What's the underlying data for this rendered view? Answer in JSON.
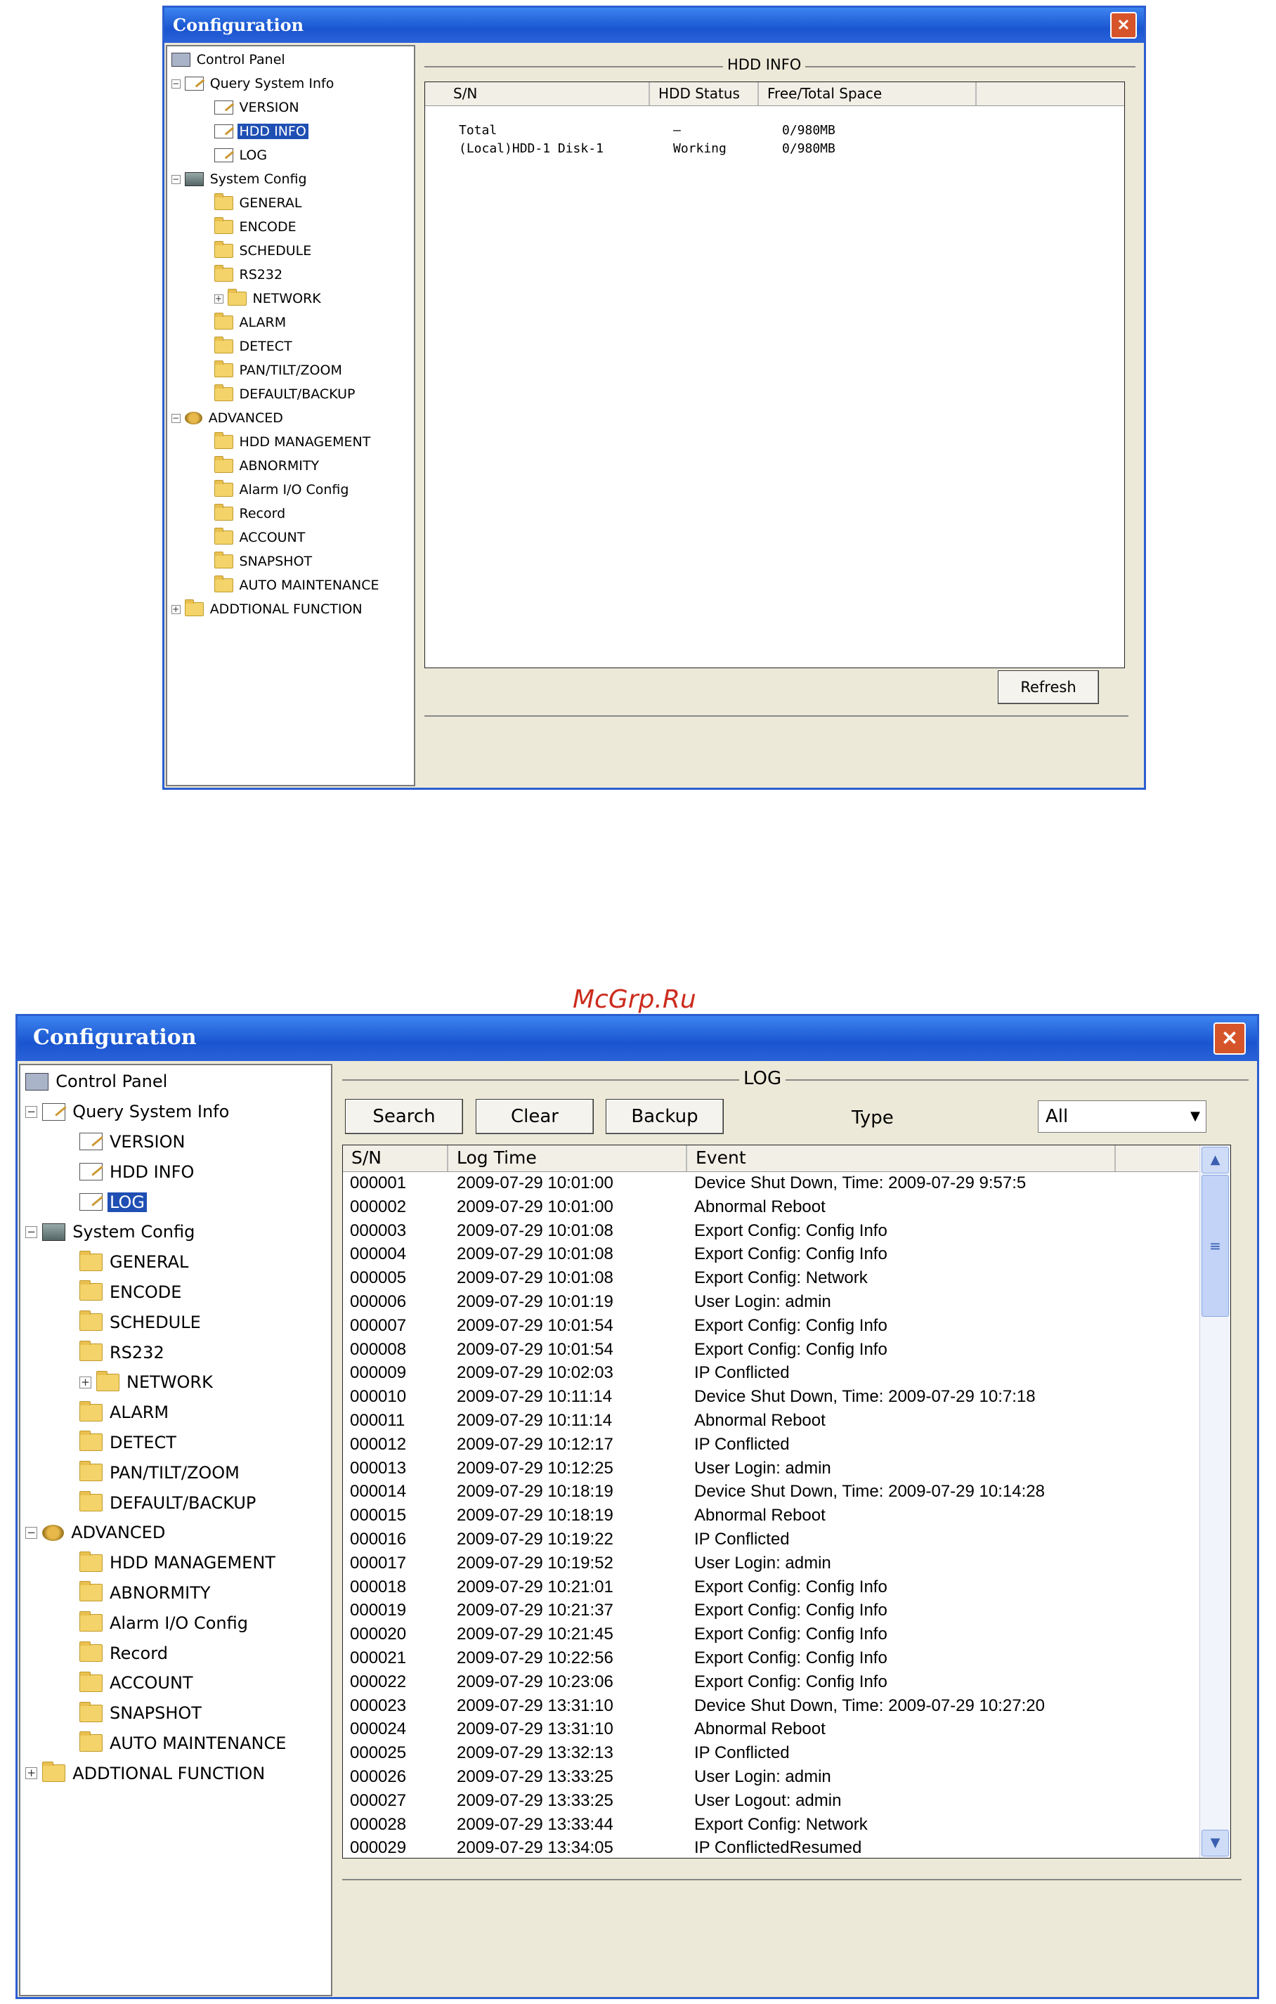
{
  "watermark": "McGrp.Ru",
  "windows": [
    {
      "title": "Configuration",
      "close_glyph": "✕",
      "tree": [
        {
          "label": "Control Panel",
          "icon": "panel-icon",
          "expander": ""
        },
        {
          "label": "Query System Info",
          "icon": "document-icon",
          "expander": "−"
        },
        {
          "label": "VERSION",
          "icon": "document-icon",
          "expander": ""
        },
        {
          "label": "HDD INFO",
          "icon": "document-icon",
          "expander": "",
          "selected": true
        },
        {
          "label": "LOG",
          "icon": "document-icon",
          "expander": ""
        },
        {
          "label": "System Config",
          "icon": "tools-icon",
          "expander": "−"
        },
        {
          "label": "GENERAL",
          "icon": "folder-icon",
          "expander": ""
        },
        {
          "label": "ENCODE",
          "icon": "folder-icon",
          "expander": ""
        },
        {
          "label": "SCHEDULE",
          "icon": "folder-icon",
          "expander": ""
        },
        {
          "label": "RS232",
          "icon": "folder-icon",
          "expander": ""
        },
        {
          "label": "NETWORK",
          "icon": "folder-icon",
          "expander": "+"
        },
        {
          "label": "ALARM",
          "icon": "folder-icon",
          "expander": ""
        },
        {
          "label": "DETECT",
          "icon": "folder-icon",
          "expander": ""
        },
        {
          "label": "PAN/TILT/ZOOM",
          "icon": "folder-icon",
          "expander": ""
        },
        {
          "label": "DEFAULT/BACKUP",
          "icon": "folder-icon",
          "expander": ""
        },
        {
          "label": "ADVANCED",
          "icon": "advanced-icon",
          "expander": "−"
        },
        {
          "label": "HDD MANAGEMENT",
          "icon": "folder-icon",
          "expander": ""
        },
        {
          "label": "ABNORMITY",
          "icon": "folder-icon",
          "expander": ""
        },
        {
          "label": "Alarm I/O Config",
          "icon": "folder-icon",
          "expander": ""
        },
        {
          "label": "Record",
          "icon": "folder-icon",
          "expander": ""
        },
        {
          "label": "ACCOUNT",
          "icon": "folder-icon",
          "expander": ""
        },
        {
          "label": "SNAPSHOT",
          "icon": "folder-icon",
          "expander": ""
        },
        {
          "label": "AUTO MAINTENANCE",
          "icon": "folder-icon",
          "expander": ""
        },
        {
          "label": "ADDTIONAL FUNCTION",
          "icon": "folder-icon",
          "expander": "+"
        }
      ],
      "section_title": "HDD INFO",
      "columns": [
        "S/N",
        "HDD Status",
        "Free/Total Space"
      ],
      "rows": [
        [
          "Total",
          "–",
          "0/980MB"
        ],
        [
          "(Local)HDD-1 Disk-1",
          "Working",
          "0/980MB"
        ]
      ],
      "refresh_label": "Refresh"
    },
    {
      "title": "Configuration",
      "close_glyph": "✕",
      "tree": [
        {
          "label": "Control Panel",
          "icon": "panel-icon",
          "expander": ""
        },
        {
          "label": "Query System Info",
          "icon": "document-icon",
          "expander": "−"
        },
        {
          "label": "VERSION",
          "icon": "document-icon",
          "expander": ""
        },
        {
          "label": "HDD INFO",
          "icon": "document-icon",
          "expander": ""
        },
        {
          "label": "LOG",
          "icon": "document-icon",
          "expander": "",
          "selected": true
        },
        {
          "label": "System Config",
          "icon": "tools-icon",
          "expander": "−"
        },
        {
          "label": "GENERAL",
          "icon": "folder-icon",
          "expander": ""
        },
        {
          "label": "ENCODE",
          "icon": "folder-icon",
          "expander": ""
        },
        {
          "label": "SCHEDULE",
          "icon": "folder-icon",
          "expander": ""
        },
        {
          "label": "RS232",
          "icon": "folder-icon",
          "expander": ""
        },
        {
          "label": "NETWORK",
          "icon": "folder-icon",
          "expander": "+"
        },
        {
          "label": "ALARM",
          "icon": "folder-icon",
          "expander": ""
        },
        {
          "label": "DETECT",
          "icon": "folder-icon",
          "expander": ""
        },
        {
          "label": "PAN/TILT/ZOOM",
          "icon": "folder-icon",
          "expander": ""
        },
        {
          "label": "DEFAULT/BACKUP",
          "icon": "folder-icon",
          "expander": ""
        },
        {
          "label": "ADVANCED",
          "icon": "advanced-icon",
          "expander": "−"
        },
        {
          "label": "HDD MANAGEMENT",
          "icon": "folder-icon",
          "expander": ""
        },
        {
          "label": "ABNORMITY",
          "icon": "folder-icon",
          "expander": ""
        },
        {
          "label": "Alarm I/O Config",
          "icon": "folder-icon",
          "expander": ""
        },
        {
          "label": "Record",
          "icon": "folder-icon",
          "expander": ""
        },
        {
          "label": "ACCOUNT",
          "icon": "folder-icon",
          "expander": ""
        },
        {
          "label": "SNAPSHOT",
          "icon": "folder-icon",
          "expander": ""
        },
        {
          "label": "AUTO MAINTENANCE",
          "icon": "folder-icon",
          "expander": ""
        },
        {
          "label": "ADDTIONAL FUNCTION",
          "icon": "folder-icon",
          "expander": "+"
        }
      ],
      "section_title": "LOG",
      "search_label": "Search",
      "clear_label": "Clear",
      "backup_label": "Backup",
      "type_label": "Type",
      "type_value": "All",
      "columns": [
        "S/N",
        "Log Time",
        "Event"
      ],
      "rows": [
        [
          "000001",
          "2009-07-29 10:01:00",
          "Device Shut Down, Time: 2009-07-29 9:57:5"
        ],
        [
          "000002",
          "2009-07-29 10:01:00",
          "Abnormal Reboot"
        ],
        [
          "000003",
          "2009-07-29 10:01:08",
          "Export Config: Config Info"
        ],
        [
          "000004",
          "2009-07-29 10:01:08",
          "Export Config: Config Info"
        ],
        [
          "000005",
          "2009-07-29 10:01:08",
          "Export Config: Network"
        ],
        [
          "000006",
          "2009-07-29 10:01:19",
          "User Login: admin"
        ],
        [
          "000007",
          "2009-07-29 10:01:54",
          "Export Config: Config Info"
        ],
        [
          "000008",
          "2009-07-29 10:01:54",
          "Export Config: Config Info"
        ],
        [
          "000009",
          "2009-07-29 10:02:03",
          "IP Conflicted"
        ],
        [
          "000010",
          "2009-07-29 10:11:14",
          "Device Shut Down, Time: 2009-07-29 10:7:18"
        ],
        [
          "000011",
          "2009-07-29 10:11:14",
          "Abnormal Reboot"
        ],
        [
          "000012",
          "2009-07-29 10:12:17",
          "IP Conflicted"
        ],
        [
          "000013",
          "2009-07-29 10:12:25",
          "User Login: admin"
        ],
        [
          "000014",
          "2009-07-29 10:18:19",
          "Device Shut Down, Time: 2009-07-29 10:14:28"
        ],
        [
          "000015",
          "2009-07-29 10:18:19",
          "Abnormal Reboot"
        ],
        [
          "000016",
          "2009-07-29 10:19:22",
          "IP Conflicted"
        ],
        [
          "000017",
          "2009-07-29 10:19:52",
          "User Login: admin"
        ],
        [
          "000018",
          "2009-07-29 10:21:01",
          "Export Config: Config Info"
        ],
        [
          "000019",
          "2009-07-29 10:21:37",
          "Export Config: Config Info"
        ],
        [
          "000020",
          "2009-07-29 10:21:45",
          "Export Config: Config Info"
        ],
        [
          "000021",
          "2009-07-29 10:22:56",
          "Export Config: Config Info"
        ],
        [
          "000022",
          "2009-07-29 10:23:06",
          "Export Config: Config Info"
        ],
        [
          "000023",
          "2009-07-29 13:31:10",
          "Device Shut Down, Time: 2009-07-29 10:27:20"
        ],
        [
          "000024",
          "2009-07-29 13:31:10",
          "Abnormal Reboot"
        ],
        [
          "000025",
          "2009-07-29 13:32:13",
          "IP Conflicted"
        ],
        [
          "000026",
          "2009-07-29 13:33:25",
          "User Login: admin"
        ],
        [
          "000027",
          "2009-07-29 13:33:25",
          "User Logout: admin"
        ],
        [
          "000028",
          "2009-07-29 13:33:44",
          "Export Config: Network"
        ],
        [
          "000029",
          "2009-07-29 13:34:05",
          "IP ConflictedResumed"
        ]
      ],
      "scroll_up": "▲",
      "scroll_down": "▼",
      "scroll_grip": "≡",
      "dropdown_arrow": "▼"
    }
  ],
  "colors": {
    "titlebar": "#1a55d0",
    "selection": "#1f4fb3",
    "close": "#d6542a",
    "watermark": "#cc2b1d"
  }
}
